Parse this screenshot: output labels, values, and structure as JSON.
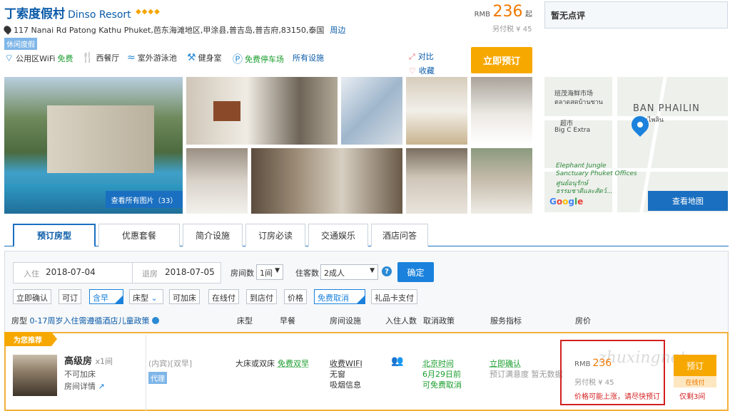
{
  "hotel": {
    "name_cn": "丁索度假村",
    "name_en": "Dinso Resort",
    "stars": "◆◆◆◆",
    "address": "117 Nanai Rd Patong Kathu Phuket,芭东海滩地区,甲涂县,普吉岛,普吉府,83150,泰国",
    "nearby_link": "周边",
    "tag": "休闲度假"
  },
  "facilities": [
    {
      "icon": "wifi-icon",
      "label": "公用区WiFi",
      "extra": "免费"
    },
    {
      "icon": "restaurant-icon",
      "label": "西餐厅"
    },
    {
      "icon": "pool-icon",
      "label": "室外游泳池"
    },
    {
      "icon": "gym-icon",
      "label": "健身室"
    },
    {
      "icon": "parking-icon",
      "label": "免费停车场"
    },
    {
      "icon": "",
      "label": "所有设施"
    }
  ],
  "price": {
    "currency": "RMB",
    "amount": "236",
    "suffix": "起",
    "tax": "另付税 ¥ 45"
  },
  "actions": {
    "compare": "对比",
    "favorite": "收藏",
    "book_now": "立即预订"
  },
  "review": "暂无点评",
  "photos": {
    "view_all": "查看所有图片（33）"
  },
  "map": {
    "labels": [
      "班茂海鲜市场",
      "ตลาดสดบ้านชาน",
      "BAN PHAILIN",
      "บ้านไพลิน",
      "超市",
      "Big C Extra",
      "Elephant Jungle",
      "Sanctuary Phuket Offices",
      "ศูนย์อนุรักษ์",
      "ธรรมชาติและสัตว์..."
    ],
    "google": "Google",
    "view_map": "查看地图"
  },
  "tabs": [
    "预订房型",
    "优惠套餐",
    "简介设施",
    "订房必读",
    "交通娱乐",
    "酒店问答"
  ],
  "search": {
    "checkin_label": "入住",
    "checkin": "2018-07-04",
    "checkout_label": "退房",
    "checkout": "2018-07-05",
    "rooms_label": "房间数",
    "rooms": "1间",
    "guests_label": "住客数",
    "guests": "2成人",
    "confirm": "确定"
  },
  "filters": [
    "立即确认",
    "可订",
    "含早",
    "床型",
    "可加床",
    "在线付",
    "到店付",
    "价格",
    "免费取消",
    "礼品卡支付"
  ],
  "columns": {
    "room_type": "房型",
    "child_policy": "0-17周岁入住需遵循酒店儿童政策",
    "bed": "床型",
    "breakfast": "早餐",
    "facilities": "房间设施",
    "occupancy": "入住人数",
    "cancel": "取消政策",
    "service": "服务指标",
    "price": "房价"
  },
  "room": {
    "recommend": "为您推荐",
    "name": "高级房",
    "count": "x1间",
    "no_extra_bed": "不可加床",
    "details": "房间详情",
    "rate_desc": "(内宾)[双早]",
    "agent": "代理",
    "bed": "大床或双床",
    "breakfast": "免费双早",
    "wifi": "收费WIFI",
    "window": "无窗",
    "smoking": "吸烟信息",
    "cancel_time": "北京时间",
    "cancel_date": "6月29日前",
    "cancel_free": "可免费取消",
    "confirm": "立即确认",
    "satisfaction": "预订满意度  暂无数据",
    "price_currency": "RMB",
    "price": "236",
    "price_tax": "另付税 ¥ 45",
    "price_warn": "价格可能上涨，请尽快预订",
    "book": "预订",
    "pay_online": "在线付",
    "left": "仅剩3间"
  },
  "watermark": "zhuxingnet"
}
